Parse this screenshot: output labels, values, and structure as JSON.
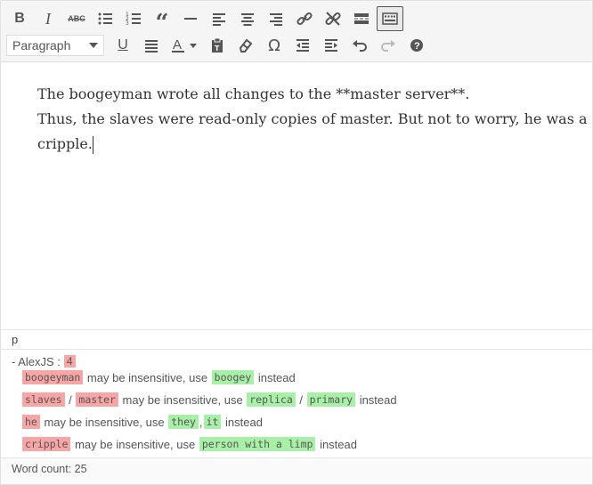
{
  "toolbar": {
    "row1": [
      "bold-icon",
      "italic-icon",
      "strikethrough-icon",
      "bullet-list-icon",
      "numbered-list-icon",
      "blockquote-icon",
      "horizontal-rule-icon",
      "align-left-icon",
      "align-center-icon",
      "align-right-icon",
      "insert-link-icon",
      "remove-link-icon",
      "read-more-icon",
      "toolbar-toggle-icon"
    ],
    "format_select": "Paragraph",
    "row2": [
      "underline-icon",
      "justify-icon",
      "text-color-icon",
      "paste-text-icon",
      "clear-formatting-icon",
      "special-character-icon",
      "decrease-indent-icon",
      "increase-indent-icon",
      "undo-icon",
      "redo-icon",
      "help-icon"
    ]
  },
  "content": {
    "line1": "The boogeyman wrote all changes to the **master server**.",
    "line2": "Thus, the slaves were read-only copies of master. But not to worry, he was a",
    "line3": "cripple."
  },
  "status_path": "p",
  "alex": {
    "label": "- AlexJS :",
    "count": "4",
    "items": [
      {
        "bad": [
          "boogeyman"
        ],
        "text": " may be insensitive, use ",
        "good": [
          "boogey"
        ],
        "tail": " instead"
      },
      {
        "bad": [
          "slaves",
          "master"
        ],
        "text": " may be insensitive, use ",
        "good": [
          "replica",
          "primary"
        ],
        "tail": " instead"
      },
      {
        "bad": [
          "he"
        ],
        "text": " may be insensitive, use ",
        "good": [
          "they",
          "it"
        ],
        "tail": " instead"
      },
      {
        "bad": [
          "cripple"
        ],
        "text": " may be insensitive, use ",
        "good": [
          "person with a limp"
        ],
        "tail": " instead"
      }
    ],
    "sep_slash": " / ",
    "sep_comma": ","
  },
  "word_count": "Word count: 25"
}
